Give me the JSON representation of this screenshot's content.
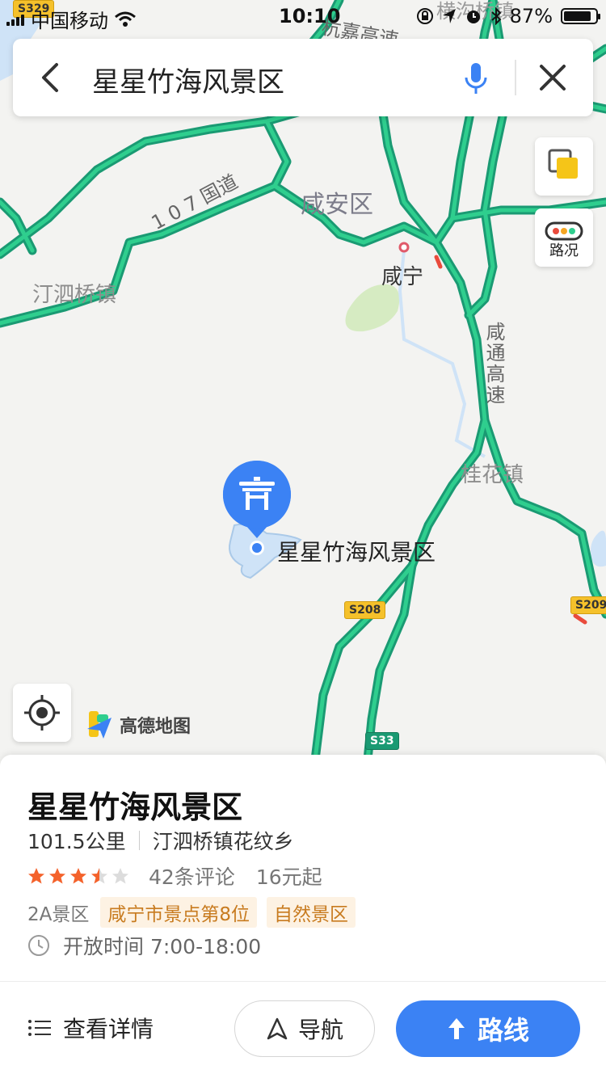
{
  "status_bar": {
    "carrier": "中国移动",
    "time": "10:10",
    "battery_text": "87%",
    "battery_level": 0.87,
    "icons": [
      "signal-icon",
      "wifi-icon",
      "rotation-lock-icon",
      "location-arrow-icon",
      "alarm-icon",
      "bluetooth-icon",
      "battery-icon"
    ]
  },
  "search": {
    "query": "星星竹海风景区"
  },
  "map": {
    "labels": {
      "district": "咸安区",
      "city": "咸宁",
      "town1": "汀泗桥镇",
      "town2": "桂花镇",
      "road_107": "1 0 7 国道",
      "road_xiantong": "咸通高速",
      "road_top": "杭嘉高速",
      "town_top": "横沟桥镇",
      "poi": "星星竹海风景区"
    },
    "shields": {
      "s329": "S329",
      "s208": "S208",
      "s209": "S209",
      "s33": "S33"
    },
    "traffic_label": "路况",
    "logo_text": "高德地图",
    "colors": {
      "road_green": "#23b47e",
      "water": "#cfe3f7",
      "park": "#d6ebc2",
      "accent_blue": "#3b82f4"
    }
  },
  "place": {
    "name": "星星竹海风景区",
    "distance": "101.5公里",
    "address": "汀泗桥镇花纹乡",
    "rating": 3.5,
    "rating_max": 5,
    "reviews": "42条评论",
    "price": "16元起",
    "grade": "2A景区",
    "tags": [
      "咸宁市景点第8位",
      "自然景区"
    ],
    "hours": "开放时间 7:00-18:00"
  },
  "actions": {
    "details": "查看详情",
    "navigate": "导航",
    "route": "路线"
  }
}
